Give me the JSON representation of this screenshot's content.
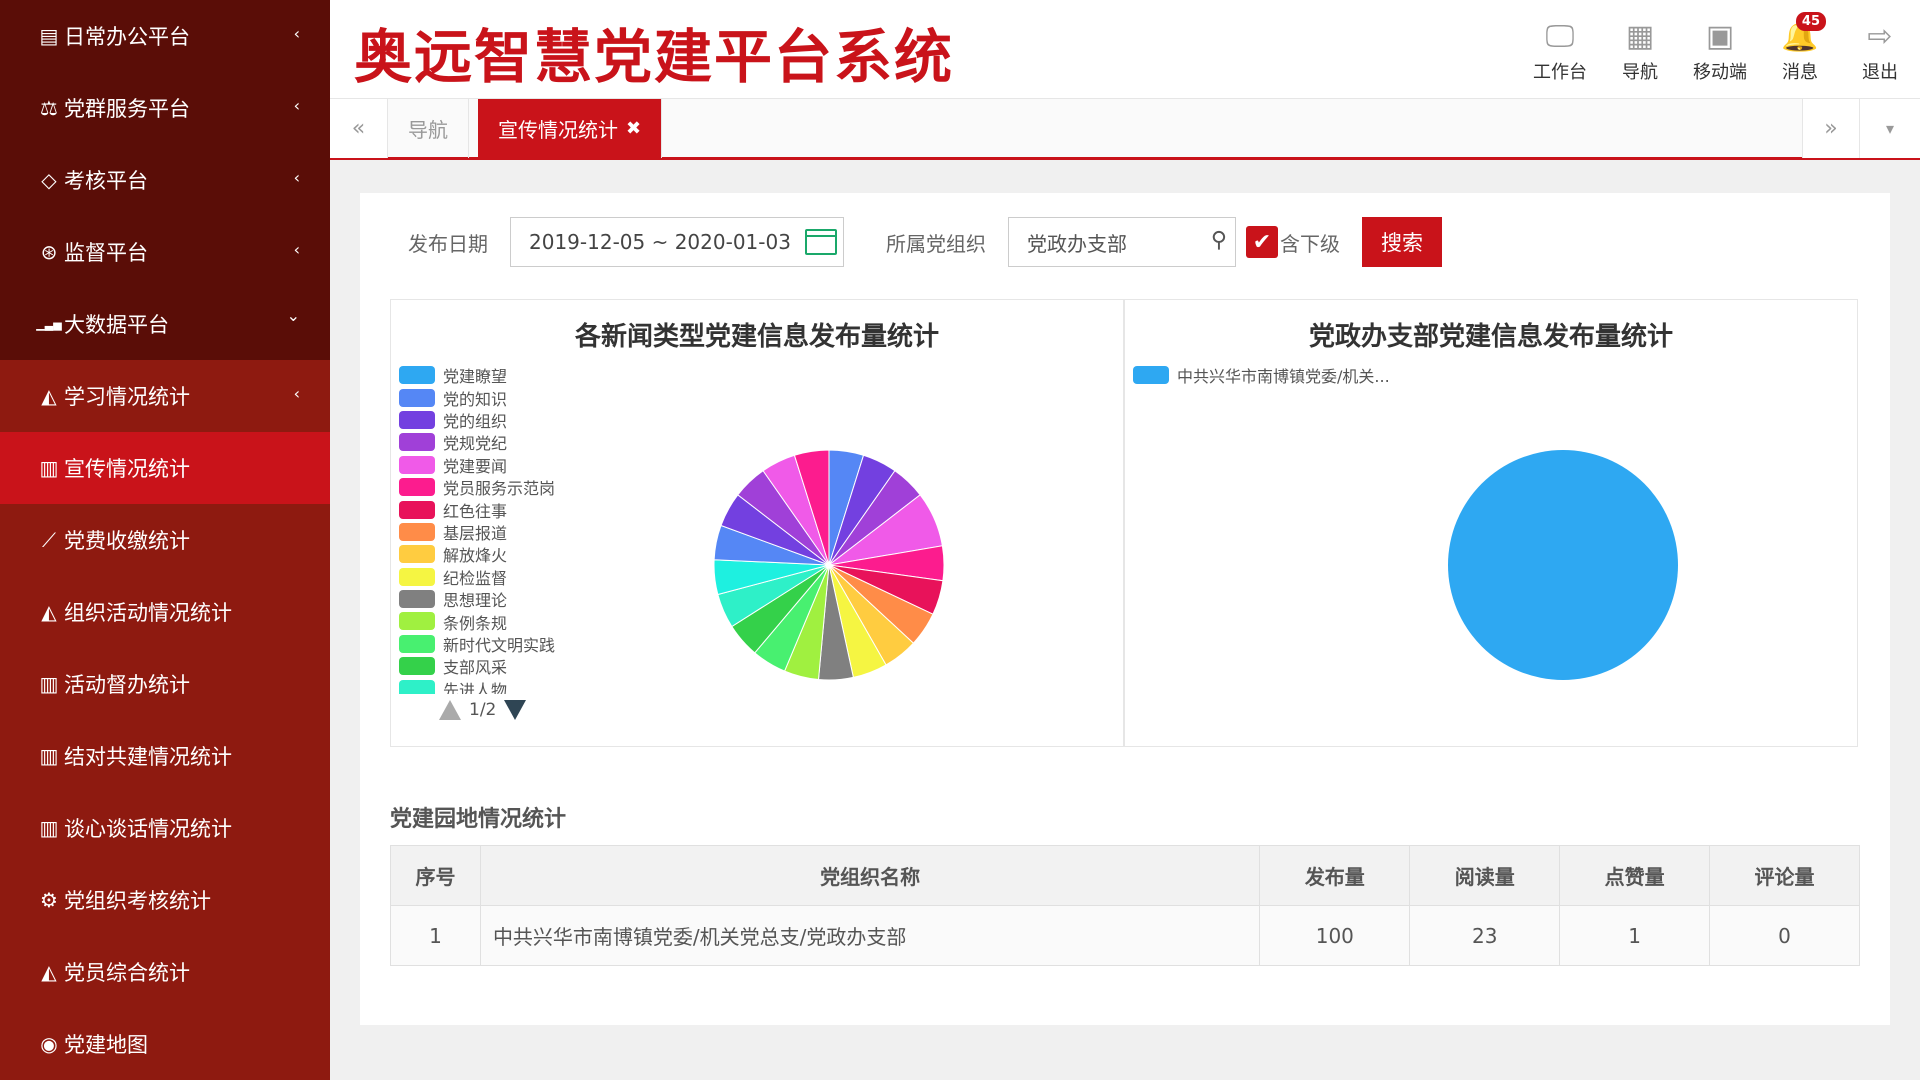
{
  "sidebar": {
    "items": [
      {
        "label": "日常办公平台",
        "icon": "file-icon",
        "glyph": "▤",
        "chev": "‹"
      },
      {
        "label": "党群服务平台",
        "icon": "scale-icon",
        "glyph": "⚖",
        "chev": "‹"
      },
      {
        "label": "考核平台",
        "icon": "diamond-icon",
        "glyph": "◇",
        "chev": "‹"
      },
      {
        "label": "监督平台",
        "icon": "lifebuoy-icon",
        "glyph": "⊛",
        "chev": "‹"
      },
      {
        "label": "大数据平台",
        "icon": "signal-icon",
        "glyph": "▁▃▅",
        "chev": "⌄"
      },
      {
        "label": "学习情况统计",
        "icon": "area-chart-icon",
        "glyph": "◭",
        "chev": "‹"
      },
      {
        "label": "宣传情况统计",
        "icon": "bar-chart-icon",
        "glyph": "▥",
        "chev": ""
      },
      {
        "label": "党费收缴统计",
        "icon": "line-chart-icon",
        "glyph": "⟋",
        "chev": ""
      },
      {
        "label": "组织活动情况统计",
        "icon": "area-chart-icon",
        "glyph": "◭",
        "chev": ""
      },
      {
        "label": "活动督办统计",
        "icon": "bar-chart-icon",
        "glyph": "▥",
        "chev": ""
      },
      {
        "label": "结对共建情况统计",
        "icon": "bar-chart-icon",
        "glyph": "▥",
        "chev": ""
      },
      {
        "label": "谈心谈话情况统计",
        "icon": "bar-chart-icon",
        "glyph": "▥",
        "chev": ""
      },
      {
        "label": "党组织考核统计",
        "icon": "gears-icon",
        "glyph": "⚙",
        "chev": ""
      },
      {
        "label": "党员综合统计",
        "icon": "area-chart-icon",
        "glyph": "◭",
        "chev": ""
      },
      {
        "label": "党建地图",
        "icon": "globe-icon",
        "glyph": "◉",
        "chev": ""
      }
    ]
  },
  "header": {
    "title": "奥远智慧党建平台系统",
    "nav": [
      {
        "label": "工作台",
        "icon": "desktop-icon",
        "glyph": "🖵"
      },
      {
        "label": "导航",
        "icon": "grid-icon",
        "glyph": "▦"
      },
      {
        "label": "移动端",
        "icon": "qrcode-icon",
        "glyph": "▣"
      },
      {
        "label": "消息",
        "icon": "bell-icon",
        "glyph": "🔔",
        "badge": "45"
      },
      {
        "label": "退出",
        "icon": "sign-out-icon",
        "glyph": "⇨"
      }
    ]
  },
  "tabs": {
    "prev": "«",
    "next": "»",
    "menu": "▾",
    "items": [
      {
        "label": "导航"
      },
      {
        "label": "宣传情况统计",
        "close": "✖"
      }
    ]
  },
  "filter": {
    "date_label": "发布日期",
    "date_value": "2019-12-05 ~ 2020-01-03",
    "org_label": "所属党组织",
    "org_value": "党政办支部",
    "checkbox_label": "含下级",
    "check_glyph": "✔",
    "search_glyph": "⚲",
    "search_button": "搜索"
  },
  "charts": {
    "left_title": "各新闻类型党建信息发布量统计",
    "right_title": "党政办支部党建信息发布量统计",
    "pager": "1/2"
  },
  "chart_data": [
    {
      "type": "pie",
      "title": "各新闻类型党建信息发布量统计",
      "legend": "left-paged",
      "categories": [
        "党建瞭望",
        "党的知识",
        "党的组织",
        "党规党纪",
        "党建要闻",
        "党员服务示范岗",
        "红色往事",
        "基层报道",
        "解放烽火",
        "纪检监督",
        "思想理论",
        "条例条规",
        "新时代文明实践",
        "支部风采",
        "先进人物"
      ],
      "colors": [
        "#2ea8f2",
        "#5587f5",
        "#7340e0",
        "#a040d8",
        "#f05ae8",
        "#fc1c8e",
        "#e8125a",
        "#ff8c48",
        "#ffcc40",
        "#f5f542",
        "#808080",
        "#a0f040",
        "#48f070",
        "#34d14a",
        "#2ef0c8"
      ],
      "slices": [
        {
          "color": "#5587f5",
          "value": 5
        },
        {
          "color": "#7340e0",
          "value": 5
        },
        {
          "color": "#a040d8",
          "value": 5
        },
        {
          "color": "#f05ae8",
          "value": 8
        },
        {
          "color": "#fc1c8e",
          "value": 5
        },
        {
          "color": "#e8125a",
          "value": 5
        },
        {
          "color": "#ff8c48",
          "value": 5
        },
        {
          "color": "#ffcc40",
          "value": 5
        },
        {
          "color": "#f5f542",
          "value": 5
        },
        {
          "color": "#808080",
          "value": 5
        },
        {
          "color": "#a0f040",
          "value": 5
        },
        {
          "color": "#48f070",
          "value": 5
        },
        {
          "color": "#34d14a",
          "value": 5
        },
        {
          "color": "#2ef0c8",
          "value": 5
        },
        {
          "color": "#1ef0e0",
          "value": 5
        },
        {
          "color": "#5587f5",
          "value": 5
        },
        {
          "color": "#7340e0",
          "value": 5
        },
        {
          "color": "#a040d8",
          "value": 5
        },
        {
          "color": "#f05ae8",
          "value": 5
        },
        {
          "color": "#fc1c8e",
          "value": 5
        }
      ]
    },
    {
      "type": "pie",
      "title": "党政办支部党建信息发布量统计",
      "legend": "top-left",
      "categories": [
        "中共兴华市南博镇党委/机关..."
      ],
      "colors": [
        "#2ea8f2"
      ],
      "values": [
        100
      ]
    }
  ],
  "table": {
    "section_title": "党建园地情况统计",
    "columns": [
      "序号",
      "党组织名称",
      "发布量",
      "阅读量",
      "点赞量",
      "评论量"
    ],
    "rows": [
      [
        "1",
        "中共兴华市南博镇党委/机关党总支/党政办支部",
        "100",
        "23",
        "1",
        "0"
      ]
    ]
  }
}
